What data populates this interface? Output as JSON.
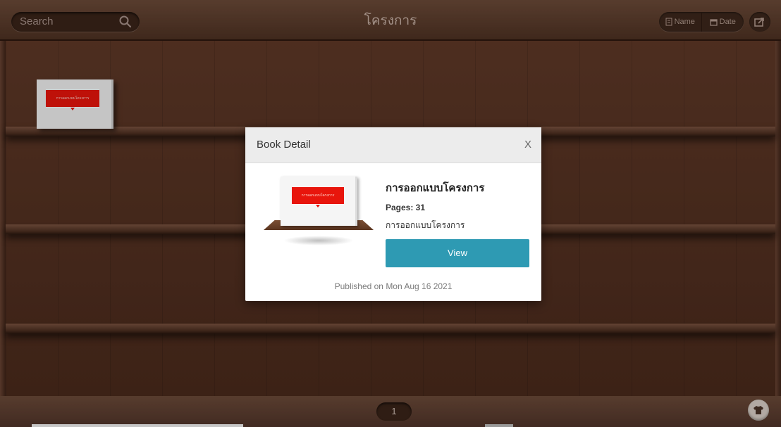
{
  "header": {
    "search_placeholder": "Search",
    "title": "โครงการ",
    "sort_name_label": "Name",
    "sort_date_label": "Date"
  },
  "shelf": {
    "book_cover_text": "การออกแบบโครงการ"
  },
  "pagination": {
    "current_page": "1"
  },
  "modal": {
    "title": "Book Detail",
    "close_label": "X",
    "book_title": "การออกแบบโครงการ",
    "pages_text": "Pages: 31",
    "description": "การออกแบบโครงการ",
    "view_label": "View",
    "published_text": "Published on Mon Aug 16 2021",
    "cover_text": "การออกแบบโครงการ"
  },
  "colors": {
    "accent_button": "#2e9ab3",
    "cover_red": "#e8150c",
    "wood_dark": "#4a2a1c"
  },
  "icons": [
    "search-icon",
    "name-sort-icon",
    "calendar-icon",
    "share-icon",
    "shirt-icon"
  ]
}
